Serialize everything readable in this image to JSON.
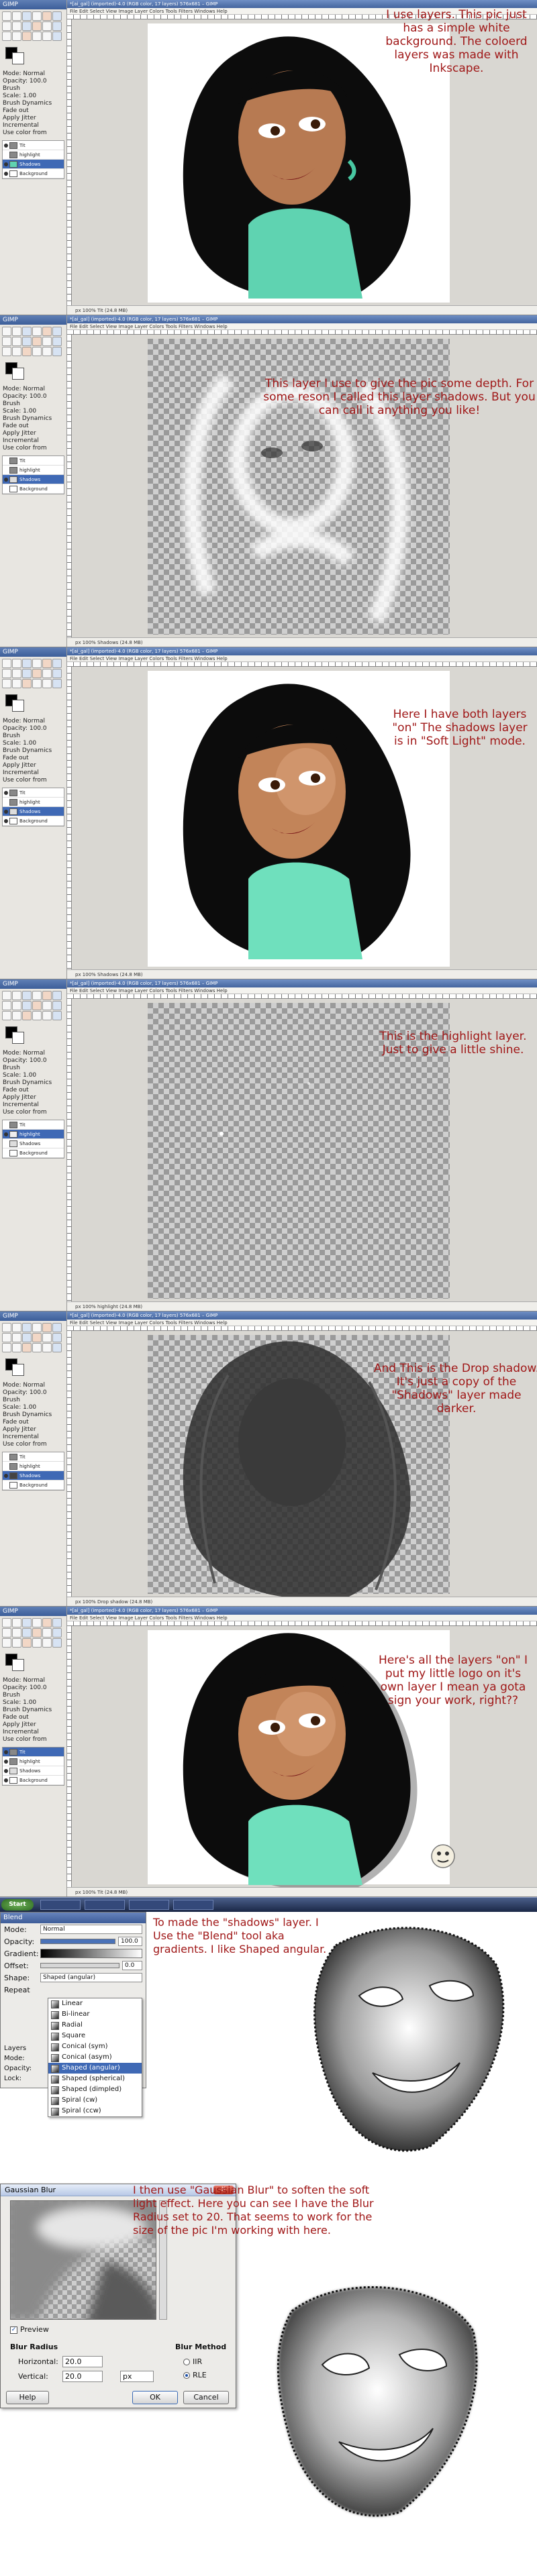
{
  "app": {
    "toolbox_title": "GIMP",
    "image_window_title": "*[ai_gal] (imported)-4.0 (RGB color, 17 layers) 576x681 – GIMP",
    "menu_items": [
      "File",
      "Edit",
      "Select",
      "View",
      "Image",
      "Layer",
      "Colors",
      "Tools",
      "Filters",
      "Windows",
      "Help"
    ],
    "zoom": "100%",
    "tool_options": [
      "Mode: Normal",
      "Opacity: 100.0",
      "Brush",
      "Scale: 1.00",
      "Brush Dynamics",
      "Fade out",
      "Apply Jitter",
      "Incremental",
      "Use color from gradient"
    ],
    "layers": [
      "Tit",
      "highlight",
      "Shadows",
      "Background"
    ],
    "statusbar": [
      "px 100% Tit (24.8 MB)",
      "px 100% Shadows (24.8 MB)",
      "px 100% Shadows (24.8 MB)",
      "px 100% highlight (24.8 MB)",
      "px 100% Drop shadow (24.8 MB)",
      "px 100% Tit (24.8 MB)"
    ]
  },
  "panels": [
    {
      "note": "I use layers. This pic just has a simple white background. The coloerd layers was made with Inkscape.",
      "style": "white-bg"
    },
    {
      "note": "This layer I use to give the pic some depth. For some reson I called this layer shadows. But you can call it anything you like!",
      "style": "shadows"
    },
    {
      "note": "Here I have both layers \"on\" The shadows layer is in \"Soft Light\" mode.",
      "style": "both"
    },
    {
      "note": "This is the highlight layer. Just to give a little shine.",
      "style": "highlight"
    },
    {
      "note": "And This is the Drop shadow. It's just a copy of the \"Shadows\" layer made darker.",
      "style": "drop"
    },
    {
      "note": "Here's all the layers \"on\" I put my little logo on it's own layer I mean ya gota sign your work, right??",
      "style": "all"
    }
  ],
  "blend_dialog": {
    "title": "Blend",
    "mode_label": "Mode:",
    "mode_value": "Normal",
    "opacity_label": "Opacity:",
    "opacity_value": "100.0",
    "gradient_label": "Gradient:",
    "offset_label": "Offset:",
    "offset_value": "0.0",
    "shape_label": "Shape:",
    "shape_value": "Shaped (angular)",
    "repeat_label": "Repeat",
    "shapes": [
      "Linear",
      "Bi-linear",
      "Radial",
      "Square",
      "Conical (sym)",
      "Conical (asym)",
      "Shaped (angular)",
      "Shaped (spherical)",
      "Shaped (dimpled)",
      "Spiral (cw)",
      "Spiral (ccw)"
    ],
    "selected_shape": "Shaped (angular)",
    "side_labels": [
      "Layers",
      "Mode:",
      "Opacity:",
      "Lock:"
    ],
    "note": "To made the \"shadows\" layer. I Use the \"Blend\" tool aka gradients. I like Shaped angular."
  },
  "gaussian_dialog": {
    "title": "Gaussian Blur",
    "close": "X",
    "preview_label": "Preview",
    "blur_radius_label": "Blur Radius",
    "horizontal_label": "Horizontal:",
    "horizontal_value": "20.0",
    "vertical_label": "Vertical:",
    "vertical_value": "20.0",
    "unit": "px",
    "blur_method_label": "Blur Method",
    "methods": [
      "IIR",
      "RLE"
    ],
    "selected_method": "RLE",
    "help_button": "Help",
    "ok_button": "OK",
    "cancel_button": "Cancel",
    "note": "I then use \"Gaussian Blur\" to soften the soft light effect. Here you can see I have the Blur Radius set to 20. That seems to work for the size of the pic I'm working with here."
  },
  "taskbar": {
    "start_label": "Start"
  },
  "colors": {
    "note_red": "#a01818",
    "selection_blue": "#3f69b5",
    "skin": "#b77a52",
    "shirt": "#5fd3b1"
  }
}
